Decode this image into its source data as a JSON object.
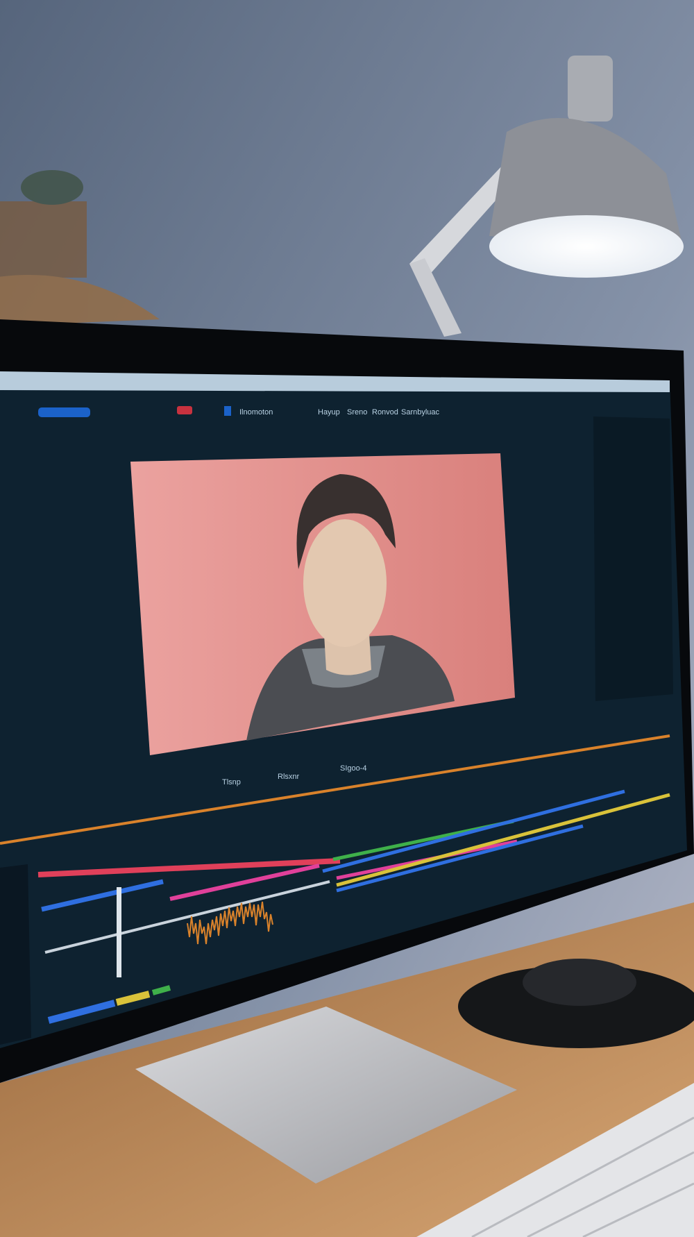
{
  "scene": {
    "description_free": true,
    "colors": {
      "wall": "#7e8ea6",
      "canvas_pink": "#e38b87",
      "screen_bg": "#0e2230",
      "desk_wood": "#c7935e",
      "accent_orange": "#d9822b",
      "track_blue": "#2f6fe0",
      "track_green": "#3fb04a",
      "track_pink": "#e0409a",
      "track_yellow": "#d9c23a"
    }
  },
  "editor": {
    "menu": [
      "Hayup",
      "Sreno",
      "Ronvod",
      "Sarnbyluac"
    ],
    "title_tab": "Ilnomoton",
    "timeline_labels": [
      "Tlsnp",
      "Rlsxnr",
      "SIgoo-4"
    ]
  }
}
